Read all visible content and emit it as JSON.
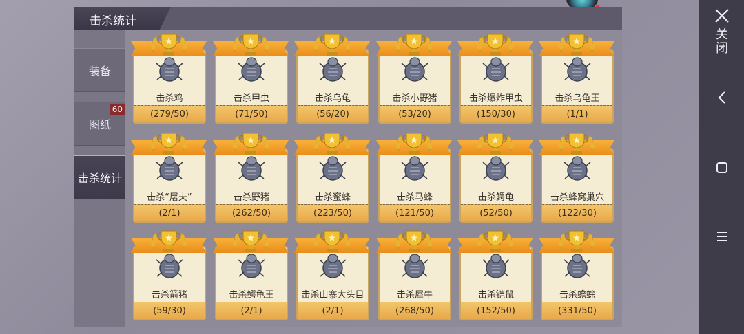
{
  "header": {
    "title": "击杀统计"
  },
  "sidebar": {
    "tabs": [
      {
        "label": "装备",
        "badge": ""
      },
      {
        "label": "图纸",
        "badge": "60"
      },
      {
        "label": "击杀统计",
        "badge": ""
      }
    ],
    "active": 2
  },
  "nav": {
    "close_label": "关闭",
    "close_icon": "close-icon",
    "back_icon": "back-icon",
    "home_icon": "home-icon",
    "menu_icon": "menu-icon"
  },
  "colors": {
    "ribbon": "#f8b13a",
    "card": "#f4ecd3",
    "foot": "#f3c56b",
    "trophy": "#f2c133"
  },
  "cards": [
    {
      "name": "击杀鸡",
      "count": "(279/50)",
      "icon": "chicken-icon"
    },
    {
      "name": "击杀甲虫",
      "count": "(71/50)",
      "icon": "beetle-icon"
    },
    {
      "name": "击杀乌龟",
      "count": "(56/20)",
      "icon": "turtle-icon"
    },
    {
      "name": "击杀小野猪",
      "count": "(53/20)",
      "icon": "boar-icon"
    },
    {
      "name": "击杀爆炸甲虫",
      "count": "(150/30)",
      "icon": "bomb-beetle-icon"
    },
    {
      "name": "击杀乌龟王",
      "count": "(1/1)",
      "icon": "turtle-king-icon"
    },
    {
      "name": "击杀“屠夫”",
      "count": "(2/1)",
      "icon": "butcher-icon"
    },
    {
      "name": "击杀野猪",
      "count": "(262/50)",
      "icon": "wild-boar-icon"
    },
    {
      "name": "击杀蜜蜂",
      "count": "(223/50)",
      "icon": "bee-icon"
    },
    {
      "name": "击杀马蜂",
      "count": "(121/50)",
      "icon": "wasp-icon"
    },
    {
      "name": "击杀鳄龟",
      "count": "(52/50)",
      "icon": "snapping-turtle-icon"
    },
    {
      "name": "击杀蜂窝巢穴",
      "count": "(122/30)",
      "icon": "hive-icon"
    },
    {
      "name": "击杀箭猪",
      "count": "(59/30)",
      "icon": "porcupine-icon"
    },
    {
      "name": "击杀鳄龟王",
      "count": "(2/1)",
      "icon": "snapping-turtle-king-icon"
    },
    {
      "name": "击杀山寨大头目",
      "count": "(2/1)",
      "icon": "bandit-chief-icon"
    },
    {
      "name": "击杀犀牛",
      "count": "(268/50)",
      "icon": "rhino-icon"
    },
    {
      "name": "击杀铠鼠",
      "count": "(152/50)",
      "icon": "armadillo-icon"
    },
    {
      "name": "击杀蟾蜍",
      "count": "(331/50)",
      "icon": "toad-icon"
    }
  ]
}
